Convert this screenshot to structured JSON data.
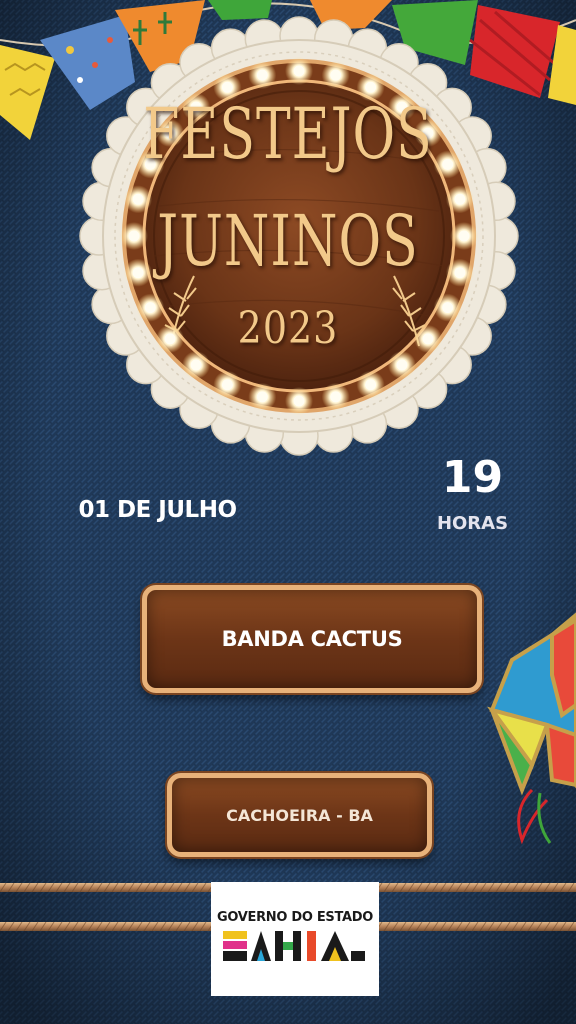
{
  "event": {
    "title_line1": "FESTEJOS",
    "title_line2": "JUNINOS",
    "year": "2023"
  },
  "schedule": {
    "date": "01 DE JULHO",
    "hour": "19",
    "hour_label": "HORAS"
  },
  "attraction": "BANDA CACTUS",
  "location": "CACHOEIRA - BA",
  "sponsor": {
    "line1": "GOVERNO DO ESTADO",
    "line2": "BAHIA"
  },
  "colors": {
    "background": "#1d3552",
    "wood": "#6d3517",
    "title_gold": "#f2c98a",
    "rope": "#c99a6a"
  }
}
